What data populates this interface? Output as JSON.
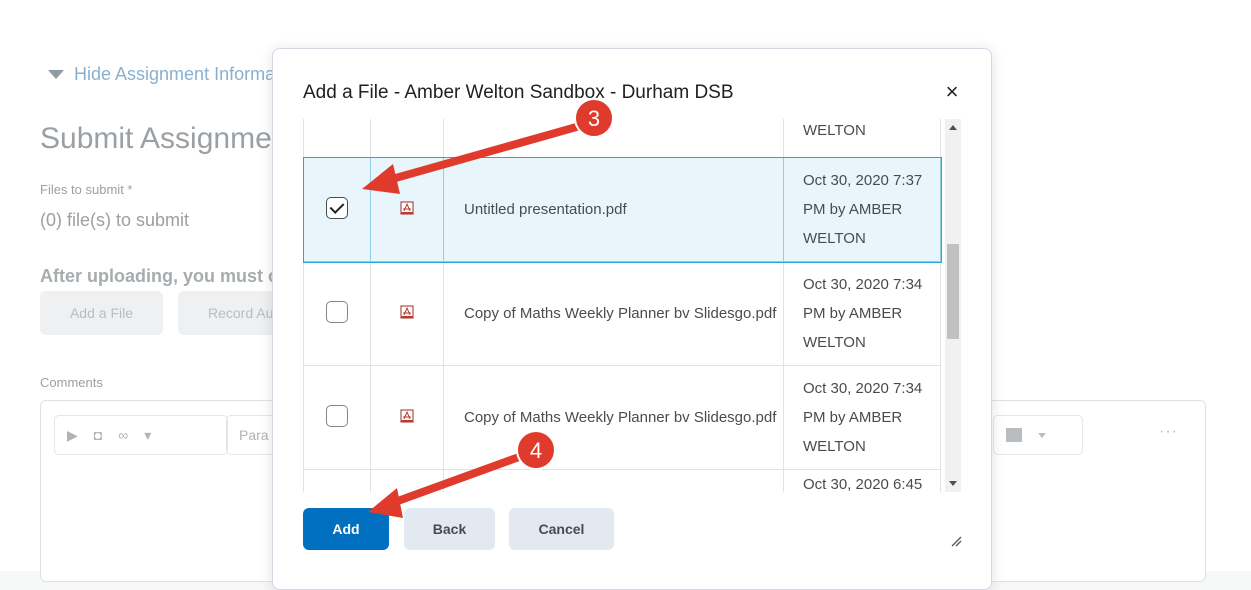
{
  "background": {
    "hide_info_label": "Hide Assignment Information",
    "submit_title": "Submit Assignment",
    "files_to_submit_label": "Files to submit *",
    "files_count": "(0) file(s) to submit",
    "after_uploading": "After uploading, you must c",
    "buttons": [
      "Add a File",
      "Record Au"
    ],
    "comments_label": "Comments",
    "editor_paragraph": "Para"
  },
  "dialog": {
    "title": "Add a File - Amber Welton Sandbox - Durham DSB",
    "close_label": "×",
    "rows": [
      {
        "name": "",
        "date": "WELTON",
        "checked": false,
        "partial": true
      },
      {
        "name": "Untitled presentation.pdf",
        "date": "Oct 30, 2020 7:37 PM by AMBER WELTON",
        "checked": true
      },
      {
        "name": "Copy of Maths Weekly Planner bv Slidesgo.pdf",
        "date": "Oct 30, 2020 7:34 PM by AMBER WELTON",
        "checked": false
      },
      {
        "name": "Copy of Maths Weekly Planner bv Slidesgo.pdf",
        "date": "Oct 30, 2020 7:34 PM by AMBER WELTON",
        "checked": false
      },
      {
        "name": "",
        "date": "Oct 30, 2020 6:45",
        "checked": false,
        "partial": true
      }
    ],
    "buttons": {
      "add": "Add",
      "back": "Back",
      "cancel": "Cancel"
    }
  },
  "annotations": [
    {
      "label": "3",
      "color": "#e03a2d"
    },
    {
      "label": "4",
      "color": "#e03a2d"
    }
  ],
  "colors": {
    "primary": "#006fbf",
    "selected_row": "#e8f6fc",
    "annotation": "#e03a2d"
  }
}
